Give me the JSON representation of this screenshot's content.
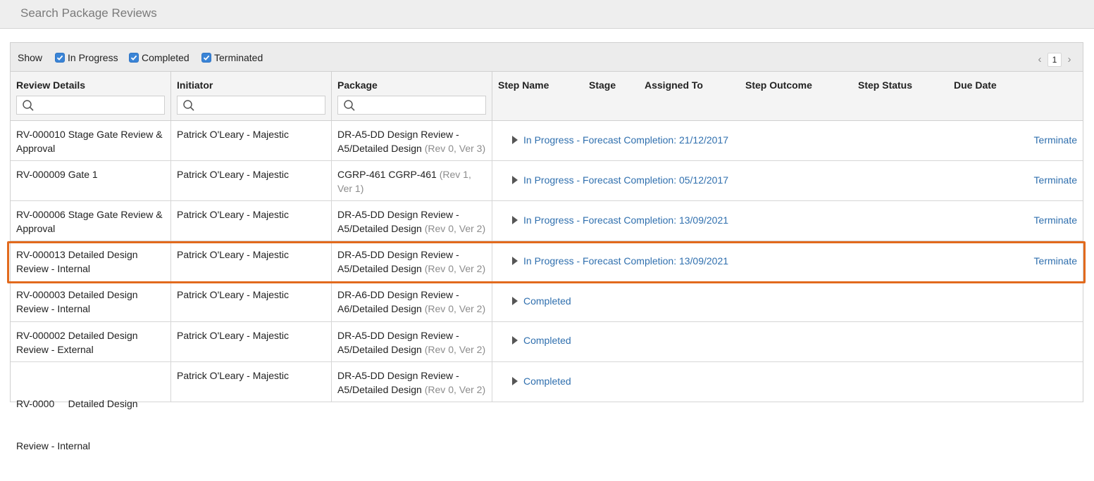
{
  "page": {
    "title": "Search Package Reviews"
  },
  "filters": {
    "show_label": "Show",
    "options": [
      {
        "label": "In Progress",
        "checked": true
      },
      {
        "label": "Completed",
        "checked": true
      },
      {
        "label": "Terminated",
        "checked": true
      }
    ]
  },
  "pager": {
    "prev": "‹",
    "current_page": "1",
    "next": "›"
  },
  "columns": {
    "review_details": "Review Details",
    "initiator": "Initiator",
    "package": "Package",
    "step_name": "Step Name",
    "stage": "Stage",
    "assigned_to": "Assigned To",
    "step_outcome": "Step Outcome",
    "step_status": "Step Status",
    "due_date": "Due Date"
  },
  "search": {
    "review_details_value": "",
    "initiator_value": "",
    "package_value": ""
  },
  "rows": [
    {
      "review_line1": "RV-000010 Stage Gate Review &",
      "review_line2": "Approval",
      "initiator": "Patrick O'Leary - Majestic",
      "package_line1": "DR-A5-DD Design Review -",
      "package_line2": "A5/Detailed Design",
      "package_rev": "(Rev 0, Ver 3)",
      "status": "In Progress - Forecast Completion: 21/12/2017",
      "action": "Terminate"
    },
    {
      "review_line1": "RV-000009 Gate 1",
      "review_line2": "",
      "initiator": "Patrick O'Leary - Majestic",
      "package_line1": "CGRP-461 CGRP-461",
      "package_line1_rev": "(Rev 1,",
      "package_line2": "",
      "package_rev": "Ver 1)",
      "status": "In Progress - Forecast Completion: 05/12/2017",
      "action": "Terminate"
    },
    {
      "review_line1": "RV-000006 Stage Gate Review &",
      "review_line2": "Approval",
      "initiator": "Patrick O'Leary - Majestic",
      "package_line1": "DR-A5-DD Design Review -",
      "package_line2": "A5/Detailed Design",
      "package_rev": "(Rev 0, Ver 2)",
      "status": "In Progress - Forecast Completion: 13/09/2021",
      "action": "Terminate"
    },
    {
      "review_line1": "RV-000013 Detailed Design",
      "review_line2": "Review - Internal",
      "initiator": "Patrick O'Leary - Majestic",
      "package_line1": "DR-A5-DD Design Review -",
      "package_line2": "A5/Detailed Design",
      "package_rev": "(Rev 0, Ver 2)",
      "status": "In Progress - Forecast Completion: 13/09/2021",
      "action": "Terminate"
    },
    {
      "review_line1": "RV-000003 Detailed Design",
      "review_line2": "Review - Internal",
      "initiator": "Patrick O'Leary - Majestic",
      "package_line1": "DR-A6-DD Design Review -",
      "package_line2": "A6/Detailed Design",
      "package_rev": "(Rev 0, Ver 2)",
      "status": "Completed",
      "action": ""
    },
    {
      "review_line1": "RV-000002 Detailed Design",
      "review_line2": "Review - External",
      "initiator": "Patrick O'Leary - Majestic",
      "package_line1": "DR-A5-DD Design Review -",
      "package_line2": "A5/Detailed Design",
      "package_rev": "(Rev 0, Ver 2)",
      "status": "Completed",
      "action": ""
    },
    {
      "review_line1": "RV-0000     Detailed Design",
      "review_line2": "Review - Internal",
      "initiator": "Patrick O'Leary - Majestic",
      "package_line1": "DR-A5-DD Design Review -",
      "package_line2": "A5/Detailed Design",
      "package_rev": "(Rev 0, Ver 2)",
      "status": "Completed",
      "action": ""
    }
  ],
  "colors": {
    "link": "#2f6fae",
    "highlight": "#e26a1d",
    "checkbox": "#3a84d6"
  }
}
